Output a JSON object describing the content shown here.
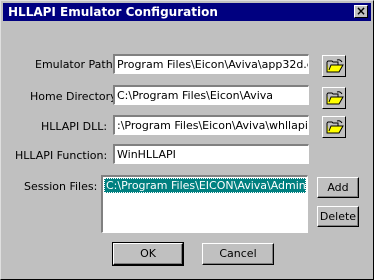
{
  "window": {
    "title": "HLLAPI Emulator Configuration",
    "close_glyph": "×"
  },
  "fields": {
    "emulator_path": {
      "label": "Emulator Path:",
      "value": "Program Files\\Eicon\\Aviva\\app32d.exe"
    },
    "home_directory": {
      "label": "Home Directory:",
      "value": "C:\\Program Files\\Eicon\\Aviva"
    },
    "hllapi_dll": {
      "label": "HLLAPI DLL:",
      "value": ":\\Program Files\\Eicon\\Aviva\\whllapi.dll"
    },
    "hllapi_function": {
      "label": "HLLAPI Function:",
      "value": "WinHLLAPI"
    }
  },
  "session_files": {
    "label": "Session Files:",
    "items": [
      "C:\\Program Files\\EICON\\Aviva\\Administrat"
    ]
  },
  "buttons": {
    "add": "Add",
    "delete": "Delete",
    "ok": "OK",
    "cancel": "Cancel"
  },
  "icons": {
    "browse": "open-folder-icon"
  },
  "colors": {
    "titlebar": "#000080",
    "selection": "#008080",
    "face": "#c0c0c0"
  }
}
